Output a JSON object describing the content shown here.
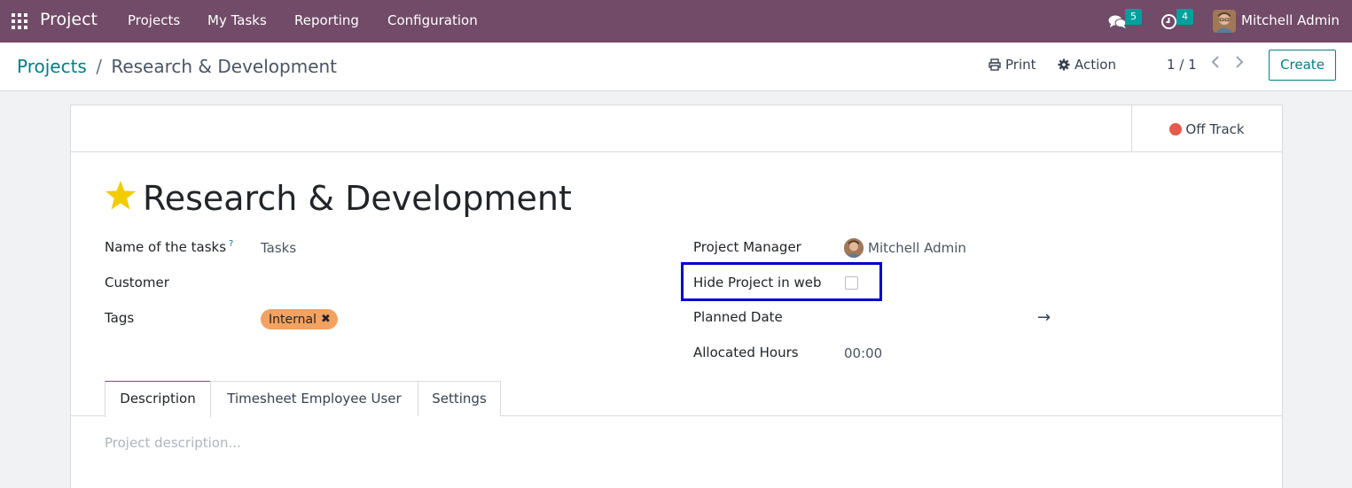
{
  "navbar": {
    "brand": "Project",
    "menu": [
      "Projects",
      "My Tasks",
      "Reporting",
      "Configuration"
    ],
    "messages_count": "5",
    "activities_count": "4",
    "user_name": "Mitchell Admin",
    "background_color": "#714b67"
  },
  "control_panel": {
    "breadcrumb_parent": "Projects",
    "breadcrumb_separator": "/",
    "breadcrumb_current": "Research & Development",
    "print_label": "Print",
    "action_label": "Action",
    "pager": "1 / 1",
    "create_label": "Create"
  },
  "status": {
    "label": "Off Track",
    "color": "#e45a4b"
  },
  "form": {
    "title": "Research & Development",
    "favorite": true,
    "left_fields": {
      "tasks_name_label": "Name of the tasks",
      "tasks_name_help": "?",
      "tasks_name_value": "Tasks",
      "customer_label": "Customer",
      "tags_label": "Tags",
      "tag": "Internal"
    },
    "right_fields": {
      "manager_label": "Project Manager",
      "manager_value": "Mitchell Admin",
      "hide_label": "Hide Project in web",
      "hide_checked": false,
      "planned_label": "Planned Date",
      "planned_arrow": "→",
      "hours_label": "Allocated Hours",
      "hours_value": "00:00"
    },
    "tabs": [
      "Description",
      "Timesheet Employee User",
      "Settings"
    ],
    "active_tab": "Description",
    "description_placeholder": "Project description..."
  },
  "icons": {
    "apps": "apps-grid-icon",
    "messages": "chat-bubbles-icon",
    "activities": "clock-icon",
    "print": "print-icon",
    "action": "gear-icon",
    "favorite": "star-icon",
    "tag_remove": "close-icon"
  }
}
